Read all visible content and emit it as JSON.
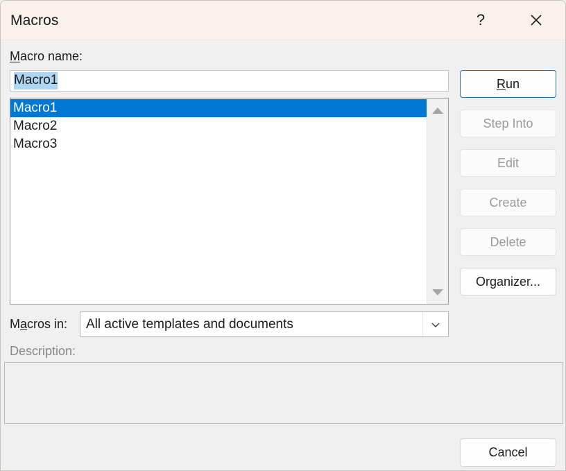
{
  "window": {
    "title": "Macros",
    "help_icon": "question-mark-icon",
    "close_icon": "close-icon"
  },
  "macro_name": {
    "label_prefix": "M",
    "label_rest": "acro name:",
    "value": "Macro1",
    "selected": true
  },
  "macro_list": {
    "items": [
      {
        "label": "Macro1",
        "selected": true
      },
      {
        "label": "Macro2",
        "selected": false
      },
      {
        "label": "Macro3",
        "selected": false
      }
    ],
    "scroll_up_icon": "triangle-up-icon",
    "scroll_down_icon": "triangle-down-icon"
  },
  "buttons": [
    {
      "key": "run",
      "label_before": "",
      "accel": "R",
      "label_after": "un",
      "enabled": true,
      "default": true
    },
    {
      "key": "step_into",
      "label_before": "",
      "accel": "",
      "label_after": "Step Into",
      "enabled": false,
      "default": false
    },
    {
      "key": "edit",
      "label_before": "",
      "accel": "",
      "label_after": "Edit",
      "enabled": false,
      "default": false
    },
    {
      "key": "create",
      "label_before": "",
      "accel": "",
      "label_after": "Create",
      "enabled": false,
      "default": false
    },
    {
      "key": "delete",
      "label_before": "",
      "accel": "",
      "label_after": "Delete",
      "enabled": false,
      "default": false
    },
    {
      "key": "organizer",
      "label_before": "Or",
      "accel": "g",
      "label_after": "anizer...",
      "enabled": true,
      "default": false
    }
  ],
  "button_labels": {
    "run_before": "",
    "run_accel": "R",
    "run_after": "un",
    "step_into": "Step Into",
    "edit": "Edit",
    "create": "Create",
    "delete": "Delete",
    "organizer_before": "Or",
    "organizer_accel": "g",
    "organizer_after": "anizer...",
    "cancel": "Cancel"
  },
  "macros_in": {
    "label_before": "M",
    "label_accel": "a",
    "label_after": "cros in:",
    "value": "All active templates and documents",
    "arrow_icon": "chevron-down-icon"
  },
  "description": {
    "label": "Description:",
    "value": "",
    "enabled": false
  },
  "colors": {
    "titlebar_bg": "#faf1ec",
    "dialog_bg": "#f0f0f0",
    "selection_blue": "#0078d4",
    "text_selection_blue": "#aed6f1",
    "default_button_border": "#2b6ca3",
    "disabled_text": "#9a9a9a"
  }
}
